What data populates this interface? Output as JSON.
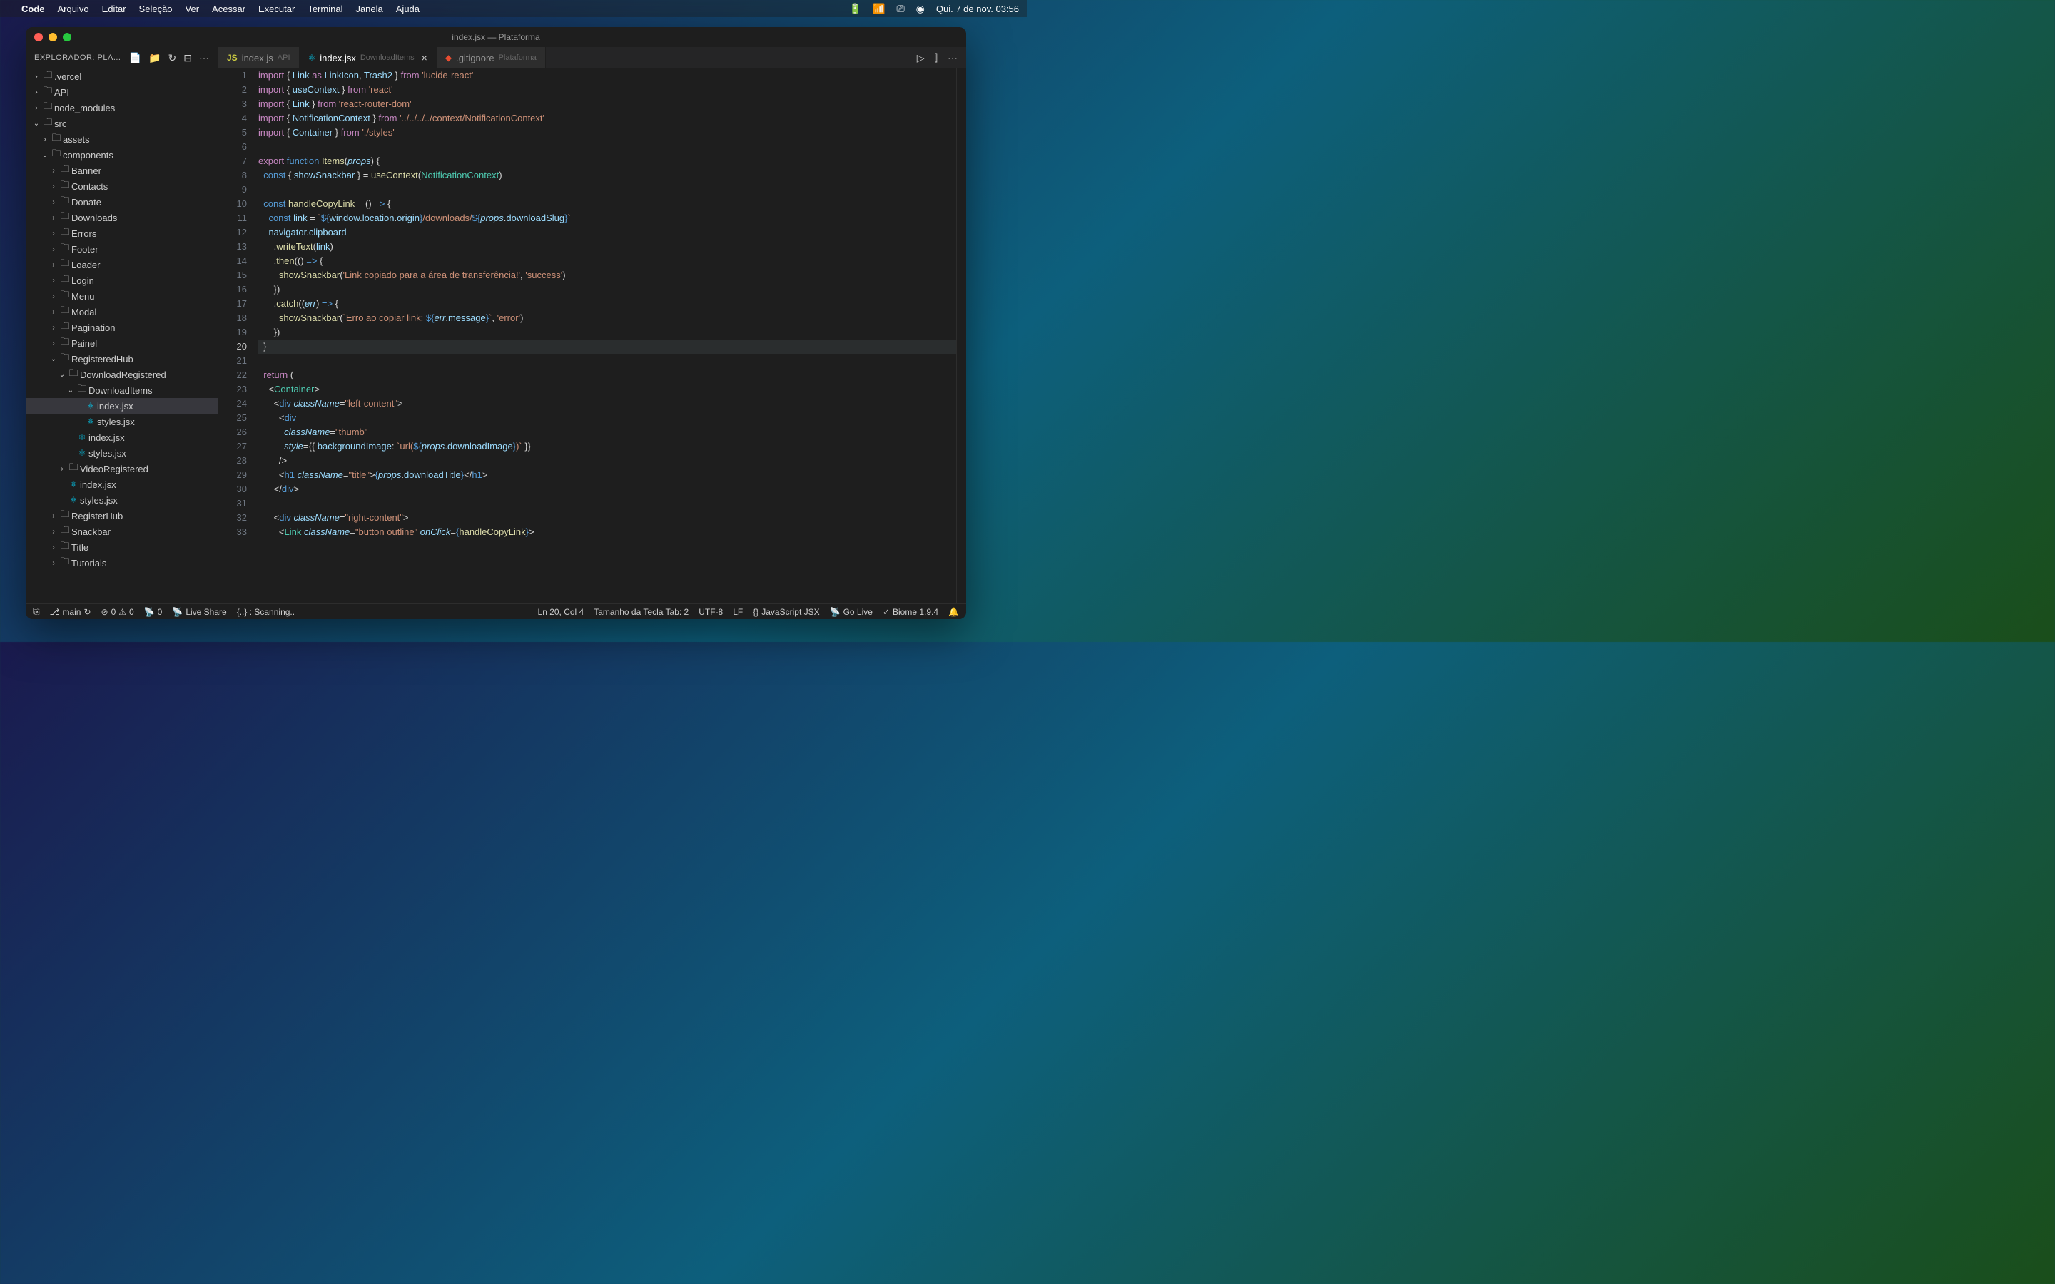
{
  "menubar": {
    "app": "Code",
    "items": [
      "Arquivo",
      "Editar",
      "Seleção",
      "Ver",
      "Acessar",
      "Executar",
      "Terminal",
      "Janela",
      "Ajuda"
    ],
    "datetime": "Qui. 7 de nov.  03:56"
  },
  "titlebar": {
    "title": "index.jsx — Plataforma"
  },
  "sidebar": {
    "header": "EXPLORADOR: PLA...",
    "tree": [
      {
        "type": "folder",
        "name": ".vercel",
        "depth": 0,
        "open": false
      },
      {
        "type": "folder",
        "name": "API",
        "depth": 0,
        "open": false
      },
      {
        "type": "folder",
        "name": "node_modules",
        "depth": 0,
        "open": false
      },
      {
        "type": "folder",
        "name": "src",
        "depth": 0,
        "open": true,
        "git": true
      },
      {
        "type": "folder",
        "name": "assets",
        "depth": 1,
        "open": false
      },
      {
        "type": "folder",
        "name": "components",
        "depth": 1,
        "open": true,
        "git": true
      },
      {
        "type": "folder",
        "name": "Banner",
        "depth": 2,
        "open": false
      },
      {
        "type": "folder",
        "name": "Contacts",
        "depth": 2,
        "open": false
      },
      {
        "type": "folder",
        "name": "Donate",
        "depth": 2,
        "open": false
      },
      {
        "type": "folder",
        "name": "Downloads",
        "depth": 2,
        "open": false
      },
      {
        "type": "folder",
        "name": "Errors",
        "depth": 2,
        "open": false
      },
      {
        "type": "folder",
        "name": "Footer",
        "depth": 2,
        "open": false
      },
      {
        "type": "folder",
        "name": "Loader",
        "depth": 2,
        "open": false
      },
      {
        "type": "folder",
        "name": "Login",
        "depth": 2,
        "open": false
      },
      {
        "type": "folder",
        "name": "Menu",
        "depth": 2,
        "open": false
      },
      {
        "type": "folder",
        "name": "Modal",
        "depth": 2,
        "open": false
      },
      {
        "type": "folder",
        "name": "Pagination",
        "depth": 2,
        "open": false
      },
      {
        "type": "folder",
        "name": "Painel",
        "depth": 2,
        "open": false
      },
      {
        "type": "folder",
        "name": "RegisteredHub",
        "depth": 2,
        "open": true
      },
      {
        "type": "folder",
        "name": "DownloadRegistered",
        "depth": 3,
        "open": true
      },
      {
        "type": "folder",
        "name": "DownloadItems",
        "depth": 4,
        "open": true
      },
      {
        "type": "file",
        "name": "index.jsx",
        "depth": 5,
        "icon": "react",
        "active": true
      },
      {
        "type": "file",
        "name": "styles.jsx",
        "depth": 5,
        "icon": "react"
      },
      {
        "type": "file",
        "name": "index.jsx",
        "depth": 4,
        "icon": "react"
      },
      {
        "type": "file",
        "name": "styles.jsx",
        "depth": 4,
        "icon": "react"
      },
      {
        "type": "folder",
        "name": "VideoRegistered",
        "depth": 3,
        "open": false
      },
      {
        "type": "file",
        "name": "index.jsx",
        "depth": 3,
        "icon": "react"
      },
      {
        "type": "file",
        "name": "styles.jsx",
        "depth": 3,
        "icon": "react"
      },
      {
        "type": "folder",
        "name": "RegisterHub",
        "depth": 2,
        "open": false
      },
      {
        "type": "folder",
        "name": "Snackbar",
        "depth": 2,
        "open": false
      },
      {
        "type": "folder",
        "name": "Title",
        "depth": 2,
        "open": false
      },
      {
        "type": "folder",
        "name": "Tutorials",
        "depth": 2,
        "open": false
      }
    ]
  },
  "tabs": [
    {
      "name": "index.js",
      "desc": "API",
      "icon": "js",
      "active": false
    },
    {
      "name": "index.jsx",
      "desc": "DownloadItems",
      "icon": "react",
      "active": true
    },
    {
      "name": ".gitignore",
      "desc": "Plataforma",
      "icon": "git",
      "active": false
    }
  ],
  "editor": {
    "current_line": 20,
    "lines": [
      {
        "n": 1,
        "html": "<span class='kw'>import</span> <span class='punc'>{</span> <span class='var'>Link</span> <span class='kw'>as</span> <span class='var'>LinkIcon</span><span class='punc'>,</span> <span class='var'>Trash2</span> <span class='punc'>}</span> <span class='kw'>from</span> <span class='str'>'lucide-react'</span>"
      },
      {
        "n": 2,
        "html": "<span class='kw'>import</span> <span class='punc'>{</span> <span class='var'>useContext</span> <span class='punc'>}</span> <span class='kw'>from</span> <span class='str'>'react'</span>"
      },
      {
        "n": 3,
        "html": "<span class='kw'>import</span> <span class='punc'>{</span> <span class='var'>Link</span> <span class='punc'>}</span> <span class='kw'>from</span> <span class='str'>'react-router-dom'</span>"
      },
      {
        "n": 4,
        "html": "<span class='kw'>import</span> <span class='punc'>{</span> <span class='var'>NotificationContext</span> <span class='punc'>}</span> <span class='kw'>from</span> <span class='str'>'../../../../context/NotificationContext'</span>"
      },
      {
        "n": 5,
        "html": "<span class='kw'>import</span> <span class='punc'>{</span> <span class='var'>Container</span> <span class='punc'>}</span> <span class='kw'>from</span> <span class='str'>'./styles'</span>"
      },
      {
        "n": 6,
        "html": ""
      },
      {
        "n": 7,
        "html": "<span class='kw'>export</span> <span class='kw2'>function</span> <span class='fn'>Items</span><span class='punc'>(</span><span class='attr'>props</span><span class='punc'>)</span> <span class='punc'>{</span>"
      },
      {
        "n": 8,
        "html": "  <span class='kw2'>const</span> <span class='punc'>{</span> <span class='var'>showSnackbar</span> <span class='punc'>}</span> <span class='op'>=</span> <span class='fn'>useContext</span><span class='punc'>(</span><span class='cls'>NotificationContext</span><span class='punc'>)</span>"
      },
      {
        "n": 9,
        "html": ""
      },
      {
        "n": 10,
        "html": "  <span class='kw2'>const</span> <span class='fn'>handleCopyLink</span> <span class='op'>=</span> <span class='punc'>()</span> <span class='kw2'>=></span> <span class='punc'>{</span>"
      },
      {
        "n": 11,
        "html": "    <span class='kw2'>const</span> <span class='var'>link</span> <span class='op'>=</span> <span class='str'>`</span><span class='kw2'>${</span><span class='var'>window</span><span class='punc'>.</span><span class='var'>location</span><span class='punc'>.</span><span class='var'>origin</span><span class='kw2'>}</span><span class='str'>/downloads/</span><span class='kw2'>${</span><span class='attr'>props</span><span class='punc'>.</span><span class='var'>downloadSlug</span><span class='kw2'>}</span><span class='str'>`</span>"
      },
      {
        "n": 12,
        "html": "    <span class='var'>navigator</span><span class='punc'>.</span><span class='var'>clipboard</span>"
      },
      {
        "n": 13,
        "html": "      <span class='punc'>.</span><span class='fn'>writeText</span><span class='punc'>(</span><span class='var'>link</span><span class='punc'>)</span>"
      },
      {
        "n": 14,
        "html": "      <span class='punc'>.</span><span class='fn'>then</span><span class='punc'>(()</span> <span class='kw2'>=></span> <span class='punc'>{</span>"
      },
      {
        "n": 15,
        "html": "        <span class='fn'>showSnackbar</span><span class='punc'>(</span><span class='str'>'Link copiado para a área de transferência!'</span><span class='punc'>,</span> <span class='str'>'success'</span><span class='punc'>)</span>"
      },
      {
        "n": 16,
        "html": "      <span class='punc'>})</span>"
      },
      {
        "n": 17,
        "html": "      <span class='punc'>.</span><span class='fn'>catch</span><span class='punc'>((</span><span class='attr'>err</span><span class='punc'>)</span> <span class='kw2'>=></span> <span class='punc'>{</span>"
      },
      {
        "n": 18,
        "html": "        <span class='fn'>showSnackbar</span><span class='punc'>(</span><span class='str'>`Erro ao copiar link: </span><span class='kw2'>${</span><span class='attr'>err</span><span class='punc'>.</span><span class='var'>message</span><span class='kw2'>}</span><span class='str'>`</span><span class='punc'>,</span> <span class='str'>'error'</span><span class='punc'>)</span>"
      },
      {
        "n": 19,
        "html": "      <span class='punc'>})</span>"
      },
      {
        "n": 20,
        "html": "  <span class='punc'>}</span>"
      },
      {
        "n": 21,
        "html": ""
      },
      {
        "n": 22,
        "html": "  <span class='kw'>return</span> <span class='punc'>(</span>"
      },
      {
        "n": 23,
        "html": "    <span class='punc'>&lt;</span><span class='comp'>Container</span><span class='punc'>&gt;</span>"
      },
      {
        "n": 24,
        "html": "      <span class='punc'>&lt;</span><span class='tag'>div</span> <span class='attr'>className</span><span class='op'>=</span><span class='str'>\"left-content\"</span><span class='punc'>&gt;</span>"
      },
      {
        "n": 25,
        "html": "        <span class='punc'>&lt;</span><span class='tag'>div</span>"
      },
      {
        "n": 26,
        "html": "          <span class='attr'>className</span><span class='op'>=</span><span class='str'>\"thumb\"</span>"
      },
      {
        "n": 27,
        "html": "          <span class='attr'>style</span><span class='op'>=</span><span class='punc'>{{</span> <span class='var'>backgroundImage</span><span class='punc'>:</span> <span class='str'>`url(</span><span class='kw2'>${</span><span class='attr'>props</span><span class='punc'>.</span><span class='var'>downloadImage</span><span class='kw2'>}</span><span class='str'>)`</span> <span class='punc'>}}</span>"
      },
      {
        "n": 28,
        "html": "        <span class='punc'>/&gt;</span>"
      },
      {
        "n": 29,
        "html": "        <span class='punc'>&lt;</span><span class='tag'>h1</span> <span class='attr'>className</span><span class='op'>=</span><span class='str'>\"title\"</span><span class='punc'>&gt;</span><span class='kw2'>{</span><span class='attr'>props</span><span class='punc'>.</span><span class='var'>downloadTitle</span><span class='kw2'>}</span><span class='punc'>&lt;/</span><span class='tag'>h1</span><span class='punc'>&gt;</span>"
      },
      {
        "n": 30,
        "html": "      <span class='punc'>&lt;/</span><span class='tag'>div</span><span class='punc'>&gt;</span>"
      },
      {
        "n": 31,
        "html": ""
      },
      {
        "n": 32,
        "html": "      <span class='punc'>&lt;</span><span class='tag'>div</span> <span class='attr'>className</span><span class='op'>=</span><span class='str'>\"right-content\"</span><span class='punc'>&gt;</span>"
      },
      {
        "n": 33,
        "html": "        <span class='punc'>&lt;</span><span class='comp'>Link</span> <span class='attr'>className</span><span class='op'>=</span><span class='str'>\"button outline\"</span> <span class='attr'>onClick</span><span class='op'>=</span><span class='kw2'>{</span><span class='fn'>handleCopyLink</span><span class='kw2'>}</span><span class='punc'>&gt;</span>"
      }
    ]
  },
  "statusbar": {
    "branch": "main",
    "errors": "0",
    "warnings": "0",
    "ports": "0",
    "live_share": "Live Share",
    "scanning": "{..} : Scanning..",
    "position": "Ln 20, Col 4",
    "tab_size": "Tamanho da Tecla Tab: 2",
    "encoding": "UTF-8",
    "eol": "LF",
    "language": "JavaScript JSX",
    "go_live": "Go Live",
    "biome": "Biome 1.9.4"
  }
}
